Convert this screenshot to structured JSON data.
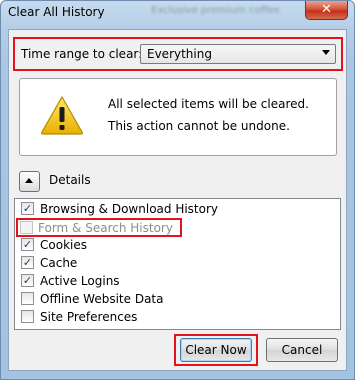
{
  "window": {
    "title": "Clear All History",
    "background_text": "Exclusive premium coffee",
    "close_glyph": "✕"
  },
  "time_range": {
    "label": "Time range to clear:",
    "selected": "Everything"
  },
  "warning": {
    "line1": "All selected items will be cleared.",
    "line2": "This action cannot be undone.",
    "icon": "warning-icon"
  },
  "details": {
    "label": "Details",
    "expanded": true
  },
  "items": [
    {
      "label": "Browsing & Download History",
      "checked": true,
      "disabled": false
    },
    {
      "label": "Form & Search History",
      "checked": false,
      "disabled": true
    },
    {
      "label": "Cookies",
      "checked": true,
      "disabled": false
    },
    {
      "label": "Cache",
      "checked": true,
      "disabled": false
    },
    {
      "label": "Active Logins",
      "checked": true,
      "disabled": false
    },
    {
      "label": "Offline Website Data",
      "checked": false,
      "disabled": false
    },
    {
      "label": "Site Preferences",
      "checked": false,
      "disabled": false
    }
  ],
  "buttons": {
    "clear": "Clear Now",
    "cancel": "Cancel"
  },
  "colors": {
    "highlight": "#e3131d",
    "titlebar": "#b6cfe8",
    "warning_yellow": "#f5c400"
  }
}
